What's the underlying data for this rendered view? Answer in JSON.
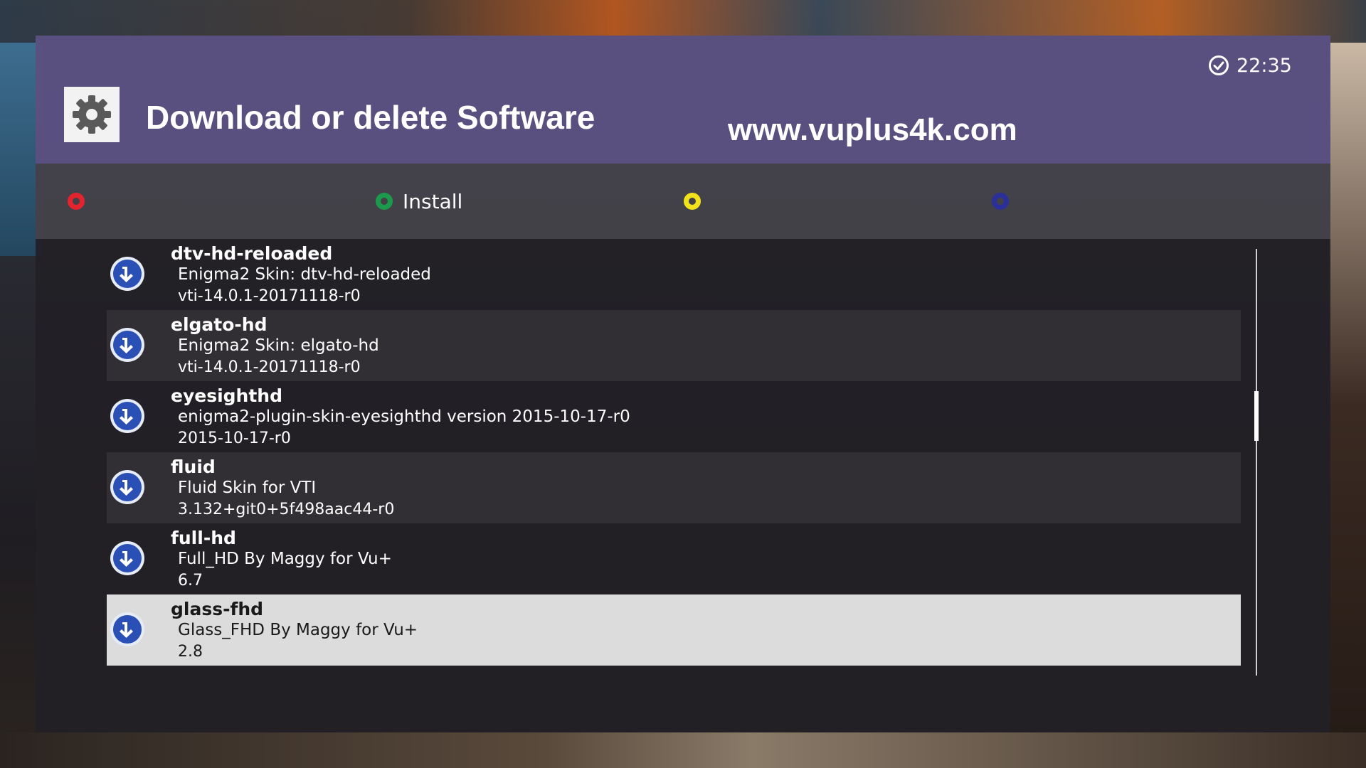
{
  "header": {
    "title": "Download or delete Software",
    "watermark": "www.vuplus4k.com",
    "clock": "22:35",
    "settings_icon": "gear-icon",
    "clock_icon": "clock-icon"
  },
  "color_buttons": [
    {
      "color": "red",
      "hex": "#e3232e",
      "label": ""
    },
    {
      "color": "green",
      "hex": "#1a9a4a",
      "label": "Install"
    },
    {
      "color": "yellow",
      "hex": "#f2e21c",
      "label": ""
    },
    {
      "color": "blue",
      "hex": "#2a2f9a",
      "label": ""
    }
  ],
  "packages": [
    {
      "name": "dtv-hd-reloaded",
      "description": "Enigma2 Skin: dtv-hd-reloaded",
      "version": "vti-14.0.1-20171118-r0",
      "icon": "download-icon"
    },
    {
      "name": "elgato-hd",
      "description": "Enigma2 Skin: elgato-hd",
      "version": "vti-14.0.1-20171118-r0",
      "icon": "download-icon"
    },
    {
      "name": "eyesighthd",
      "description": "enigma2-plugin-skin-eyesighthd version 2015-10-17-r0",
      "version": "2015-10-17-r0",
      "icon": "download-icon"
    },
    {
      "name": "fluid",
      "description": "Fluid Skin for VTI",
      "version": "3.132+git0+5f498aac44-r0",
      "icon": "download-icon"
    },
    {
      "name": "full-hd",
      "description": "Full_HD By Maggy for Vu+",
      "version": "6.7",
      "icon": "download-icon"
    },
    {
      "name": "glass-fhd",
      "description": "Glass_FHD By Maggy for Vu+",
      "version": "2.8",
      "icon": "download-icon"
    }
  ],
  "selected_index": 5,
  "colors": {
    "header_bg": "#5e5587",
    "selection_bg": "#dcdcdc",
    "icon_blue": "#2a4fb5"
  }
}
